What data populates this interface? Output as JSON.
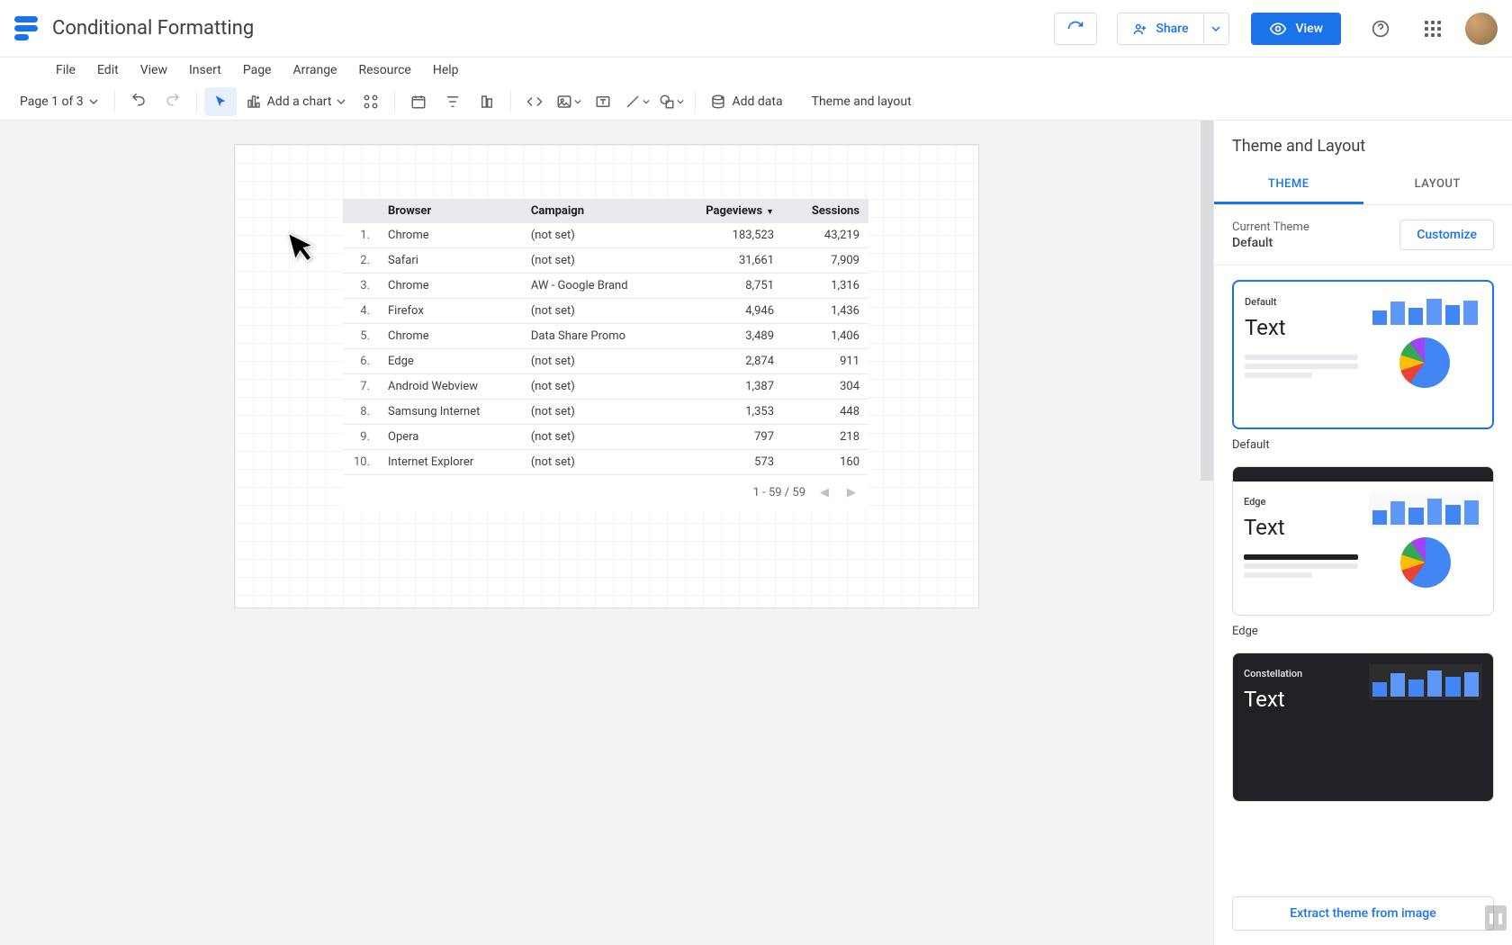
{
  "document": {
    "title": "Conditional Formatting"
  },
  "menu": {
    "items": [
      "File",
      "Edit",
      "View",
      "Insert",
      "Page",
      "Arrange",
      "Resource",
      "Help"
    ]
  },
  "header": {
    "share": "Share",
    "view": "View"
  },
  "toolbar": {
    "page_indicator": "Page 1 of 3",
    "add_chart": "Add a chart",
    "add_data": "Add data",
    "theme_layout": "Theme and layout"
  },
  "chart_data": {
    "type": "table",
    "columns": [
      "Browser",
      "Campaign",
      "Pageviews",
      "Sessions"
    ],
    "sort_column": "Pageviews",
    "sort_dir": "desc",
    "rows": [
      {
        "idx": "1.",
        "browser": "Chrome",
        "campaign": "(not set)",
        "pageviews": "183,523",
        "sessions": "43,219"
      },
      {
        "idx": "2.",
        "browser": "Safari",
        "campaign": "(not set)",
        "pageviews": "31,661",
        "sessions": "7,909"
      },
      {
        "idx": "3.",
        "browser": "Chrome",
        "campaign": "AW - Google Brand",
        "pageviews": "8,751",
        "sessions": "1,316"
      },
      {
        "idx": "4.",
        "browser": "Firefox",
        "campaign": "(not set)",
        "pageviews": "4,946",
        "sessions": "1,436"
      },
      {
        "idx": "5.",
        "browser": "Chrome",
        "campaign": "Data Share Promo",
        "pageviews": "3,489",
        "sessions": "1,406"
      },
      {
        "idx": "6.",
        "browser": "Edge",
        "campaign": "(not set)",
        "pageviews": "2,874",
        "sessions": "911"
      },
      {
        "idx": "7.",
        "browser": "Android Webview",
        "campaign": "(not set)",
        "pageviews": "1,387",
        "sessions": "304"
      },
      {
        "idx": "8.",
        "browser": "Samsung Internet",
        "campaign": "(not set)",
        "pageviews": "1,353",
        "sessions": "448"
      },
      {
        "idx": "9.",
        "browser": "Opera",
        "campaign": "(not set)",
        "pageviews": "797",
        "sessions": "218"
      },
      {
        "idx": "10.",
        "browser": "Internet Explorer",
        "campaign": "(not set)",
        "pageviews": "573",
        "sessions": "160"
      }
    ],
    "pagination": "1 - 59 / 59"
  },
  "sidebar": {
    "title": "Theme and Layout",
    "tabs": {
      "theme": "THEME",
      "layout": "LAYOUT"
    },
    "current_label": "Current Theme",
    "current_name": "Default",
    "customize": "Customize",
    "themes": [
      {
        "name": "Default",
        "label": "Default",
        "preview_text": "Text",
        "selected": true
      },
      {
        "name": "Edge",
        "label": "Edge",
        "preview_text": "Text",
        "selected": false
      },
      {
        "name": "Constellation",
        "label": "Constellation",
        "preview_text": "Text",
        "selected": false
      }
    ],
    "extract": "Extract theme from image"
  }
}
